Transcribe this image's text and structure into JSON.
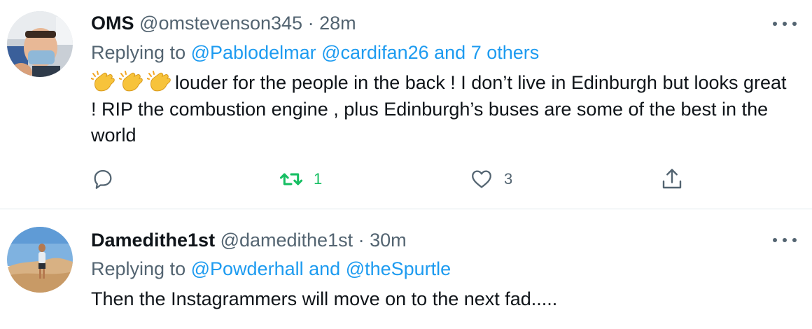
{
  "tweets": [
    {
      "display_name": "OMS",
      "handle": "@omstevenson345",
      "separator": "·",
      "time": "28m",
      "replying_prefix": "Replying to",
      "replying_user_1": "@Pablodelmar",
      "replying_user_2": "@cardifan26",
      "replying_others": "and 7 others",
      "text": "louder for the people in the back ! I don’t live in Edinburgh but looks great ! RIP the combustion engine , plus Edinburgh’s buses are some of the best in the world",
      "emoji": [
        "clapping-hands",
        "clapping-hands",
        "clapping-hands"
      ],
      "retweet_count": "1",
      "like_count": "3"
    },
    {
      "display_name": "Damedithe1st",
      "handle": "@damedithe1st",
      "separator": "·",
      "time": "30m",
      "replying_prefix": "Replying to",
      "replying_user_1": "@Powderhall",
      "replying_and": "and",
      "replying_user_2": "@theSpurtle",
      "text": "Then the Instagrammers will move on to the next fad....."
    }
  ],
  "colors": {
    "text": "#0f1419",
    "muted": "#536471",
    "link": "#1d9bf0",
    "retweet": "#17bf63",
    "divider": "#e1e8ed"
  },
  "icons": [
    "more-icon",
    "reply-icon",
    "retweet-icon",
    "like-icon",
    "share-icon"
  ]
}
